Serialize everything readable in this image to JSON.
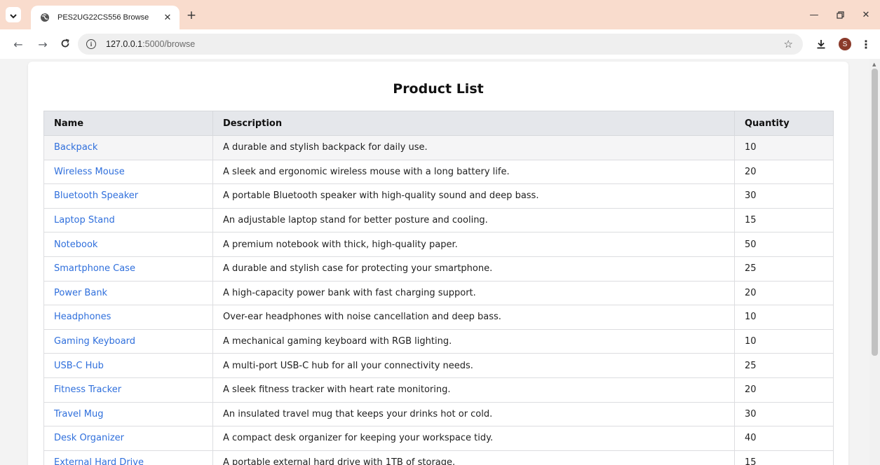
{
  "browser": {
    "tab_title": "PES2UG22CS556 Browse",
    "url_host": "127.0.0.1",
    "url_path": ":5000/browse",
    "profile_initial": "S",
    "icons": {
      "tab_menu": "chevron-down-icon",
      "favicon": "globe-icon",
      "close": "close-icon",
      "new_tab": "plus-icon",
      "back": "back-arrow-icon",
      "forward": "forward-arrow-icon",
      "reload": "reload-icon",
      "site_info": "info-icon",
      "bookmark": "star-icon",
      "downloads": "download-icon",
      "menu": "kebab-menu-icon"
    },
    "colors": {
      "tabstrip": "#f9dccd",
      "avatar": "#8a3a2a"
    }
  },
  "page": {
    "title": "Product List",
    "link_color": "#2f6fdc",
    "table": {
      "headers": {
        "name": "Name",
        "description": "Description",
        "quantity": "Quantity"
      },
      "rows": [
        {
          "name": "Backpack",
          "description": "A durable and stylish backpack for daily use.",
          "quantity": "10"
        },
        {
          "name": "Wireless Mouse",
          "description": "A sleek and ergonomic wireless mouse with a long battery life.",
          "quantity": "20"
        },
        {
          "name": "Bluetooth Speaker",
          "description": "A portable Bluetooth speaker with high-quality sound and deep bass.",
          "quantity": "30"
        },
        {
          "name": "Laptop Stand",
          "description": "An adjustable laptop stand for better posture and cooling.",
          "quantity": "15"
        },
        {
          "name": "Notebook",
          "description": "A premium notebook with thick, high-quality paper.",
          "quantity": "50"
        },
        {
          "name": "Smartphone Case",
          "description": "A durable and stylish case for protecting your smartphone.",
          "quantity": "25"
        },
        {
          "name": "Power Bank",
          "description": "A high-capacity power bank with fast charging support.",
          "quantity": "20"
        },
        {
          "name": "Headphones",
          "description": "Over-ear headphones with noise cancellation and deep bass.",
          "quantity": "10"
        },
        {
          "name": "Gaming Keyboard",
          "description": "A mechanical gaming keyboard with RGB lighting.",
          "quantity": "10"
        },
        {
          "name": "USB-C Hub",
          "description": "A multi-port USB-C hub for all your connectivity needs.",
          "quantity": "25"
        },
        {
          "name": "Fitness Tracker",
          "description": "A sleek fitness tracker with heart rate monitoring.",
          "quantity": "20"
        },
        {
          "name": "Travel Mug",
          "description": "An insulated travel mug that keeps your drinks hot or cold.",
          "quantity": "30"
        },
        {
          "name": "Desk Organizer",
          "description": "A compact desk organizer for keeping your workspace tidy.",
          "quantity": "40"
        },
        {
          "name": "External Hard Drive",
          "description": "A portable external hard drive with 1TB of storage.",
          "quantity": "15"
        }
      ]
    }
  }
}
